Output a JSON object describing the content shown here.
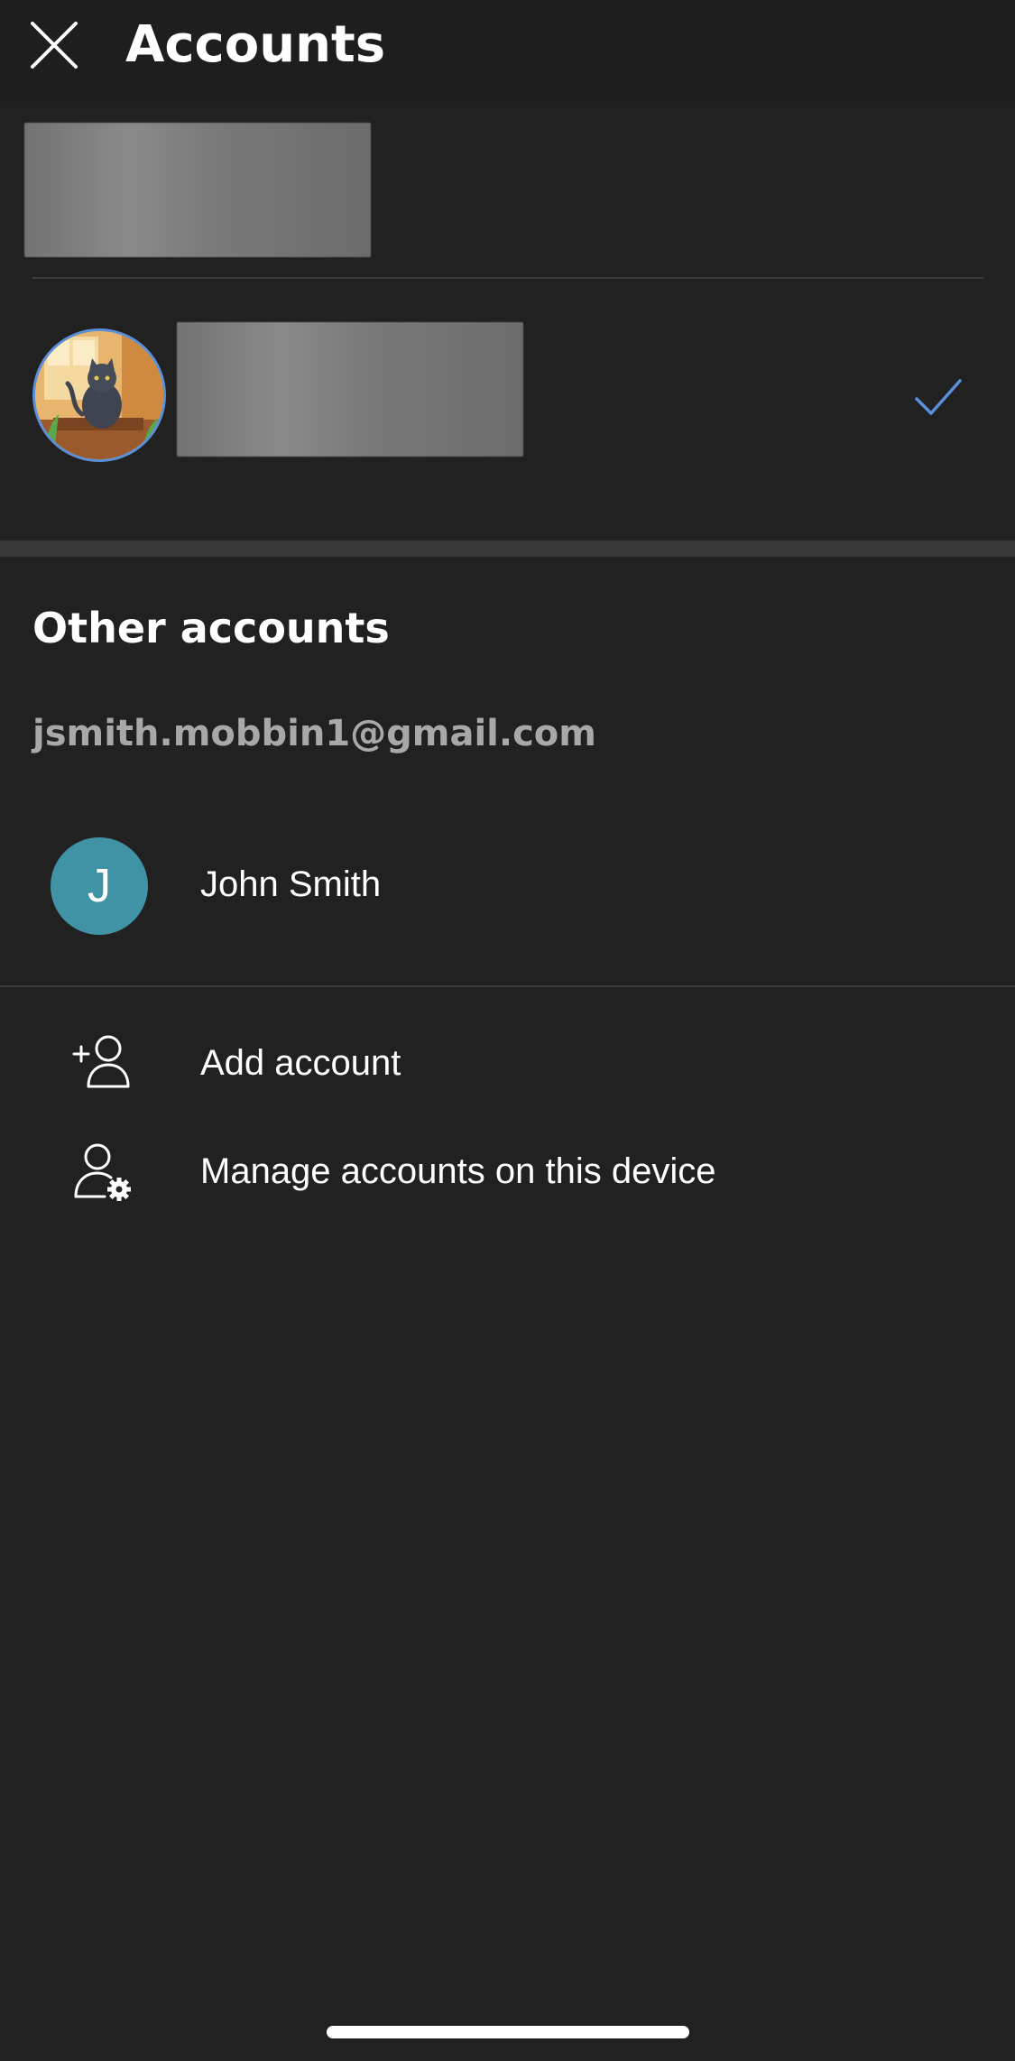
{
  "header": {
    "title": "Accounts",
    "close_icon": "close-icon"
  },
  "current_account": {
    "avatar_icon": "cat-avatar-image",
    "check_icon": "checkmark-icon",
    "accent_color": "#5b8fd9"
  },
  "other_accounts": {
    "section_title": "Other accounts",
    "email": "jsmith.mobbin1@gmail.com",
    "account": {
      "initial": "J",
      "name": "John Smith",
      "avatar_color": "#3f93a5"
    }
  },
  "actions": [
    {
      "label": "Add account",
      "icon": "add-person-icon"
    },
    {
      "label": "Manage accounts on this device",
      "icon": "person-gear-icon"
    }
  ]
}
